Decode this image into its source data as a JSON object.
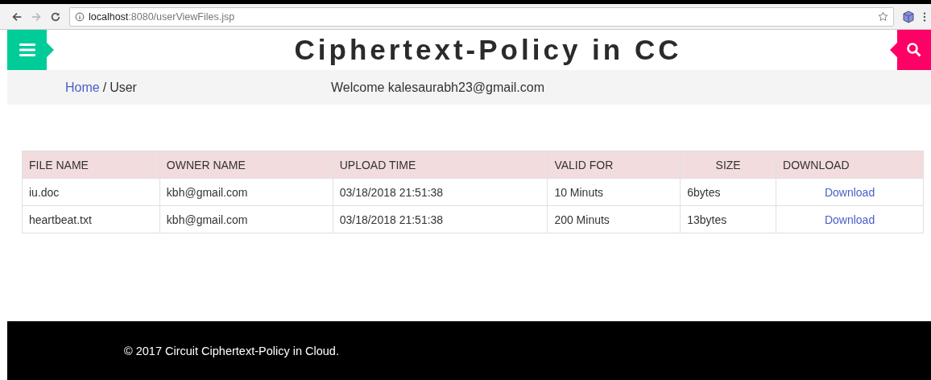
{
  "browser": {
    "url_host": "localhost",
    "url_path": ":8080/userViewFiles.jsp"
  },
  "header": {
    "title": "Ciphertext-Policy in CC"
  },
  "breadcrumb": {
    "home": "Home",
    "separator": "/",
    "current": "User"
  },
  "welcome": "Welcome kalesaurabh23@gmail.com",
  "table": {
    "columns": [
      "FILE NAME",
      "OWNER NAME",
      "UPLOAD TIME",
      "VALID FOR",
      "SIZE",
      "DOWNLOAD"
    ],
    "rows": [
      {
        "file_name": "iu.doc",
        "owner": "kbh@gmail.com",
        "upload_time": "03/18/2018 21:51:38",
        "valid_for": "10 Minuts",
        "size": "6bytes",
        "download": "Download"
      },
      {
        "file_name": "heartbeat.txt",
        "owner": "kbh@gmail.com",
        "upload_time": "03/18/2018 21:51:38",
        "valid_for": "200 Minuts",
        "size": "13bytes",
        "download": "Download"
      }
    ]
  },
  "footer": "© 2017 Circuit Ciphertext-Policy in Cloud."
}
